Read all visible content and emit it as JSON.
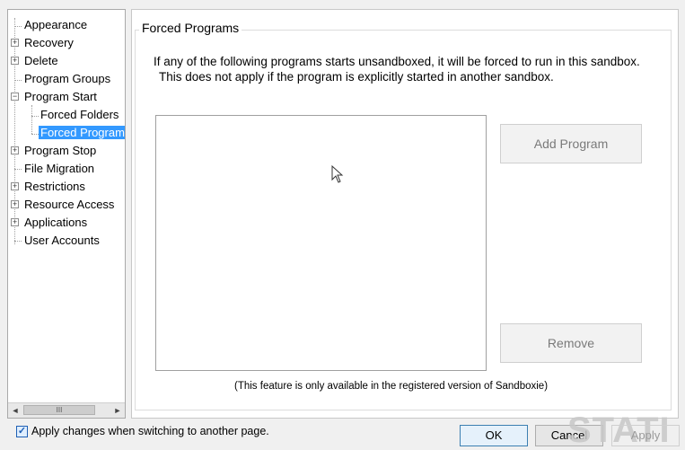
{
  "tree": {
    "items": [
      {
        "label": "Appearance",
        "expander": ""
      },
      {
        "label": "Recovery",
        "expander": "+"
      },
      {
        "label": "Delete",
        "expander": "+"
      },
      {
        "label": "Program Groups",
        "expander": ""
      },
      {
        "label": "Program Start",
        "expander": "−"
      },
      {
        "label": "Forced Folders",
        "expander": ""
      },
      {
        "label": "Forced Program",
        "expander": ""
      },
      {
        "label": "Program Stop",
        "expander": "+"
      },
      {
        "label": "File Migration",
        "expander": ""
      },
      {
        "label": "Restrictions",
        "expander": "+"
      },
      {
        "label": "Resource Access",
        "expander": "+"
      },
      {
        "label": "Applications",
        "expander": "+"
      },
      {
        "label": "User Accounts",
        "expander": ""
      }
    ],
    "selected": "Forced Program",
    "scroll_left": "◄",
    "scroll_thumb": "III",
    "scroll_right": "►"
  },
  "panel": {
    "group_title": "Forced Programs",
    "desc_line1": "If any of the following programs starts unsandboxed, it will be forced to run in this sandbox.",
    "desc_line2": "This does not apply if the program is explicitly started in another sandbox.",
    "add_button": "Add Program",
    "remove_button": "Remove",
    "note": "(This feature is only available in the registered version of Sandboxie)"
  },
  "footer": {
    "checkbox_checked": true,
    "checkbox_mark": "✓",
    "checkbox_label": "Apply changes when switching to another page.",
    "ok": "OK",
    "cancel": "Cancel",
    "apply": "Apply"
  },
  "watermark": "STATI",
  "colors": {
    "selection": "#3399ff",
    "accent_border": "#3c7fb1"
  }
}
